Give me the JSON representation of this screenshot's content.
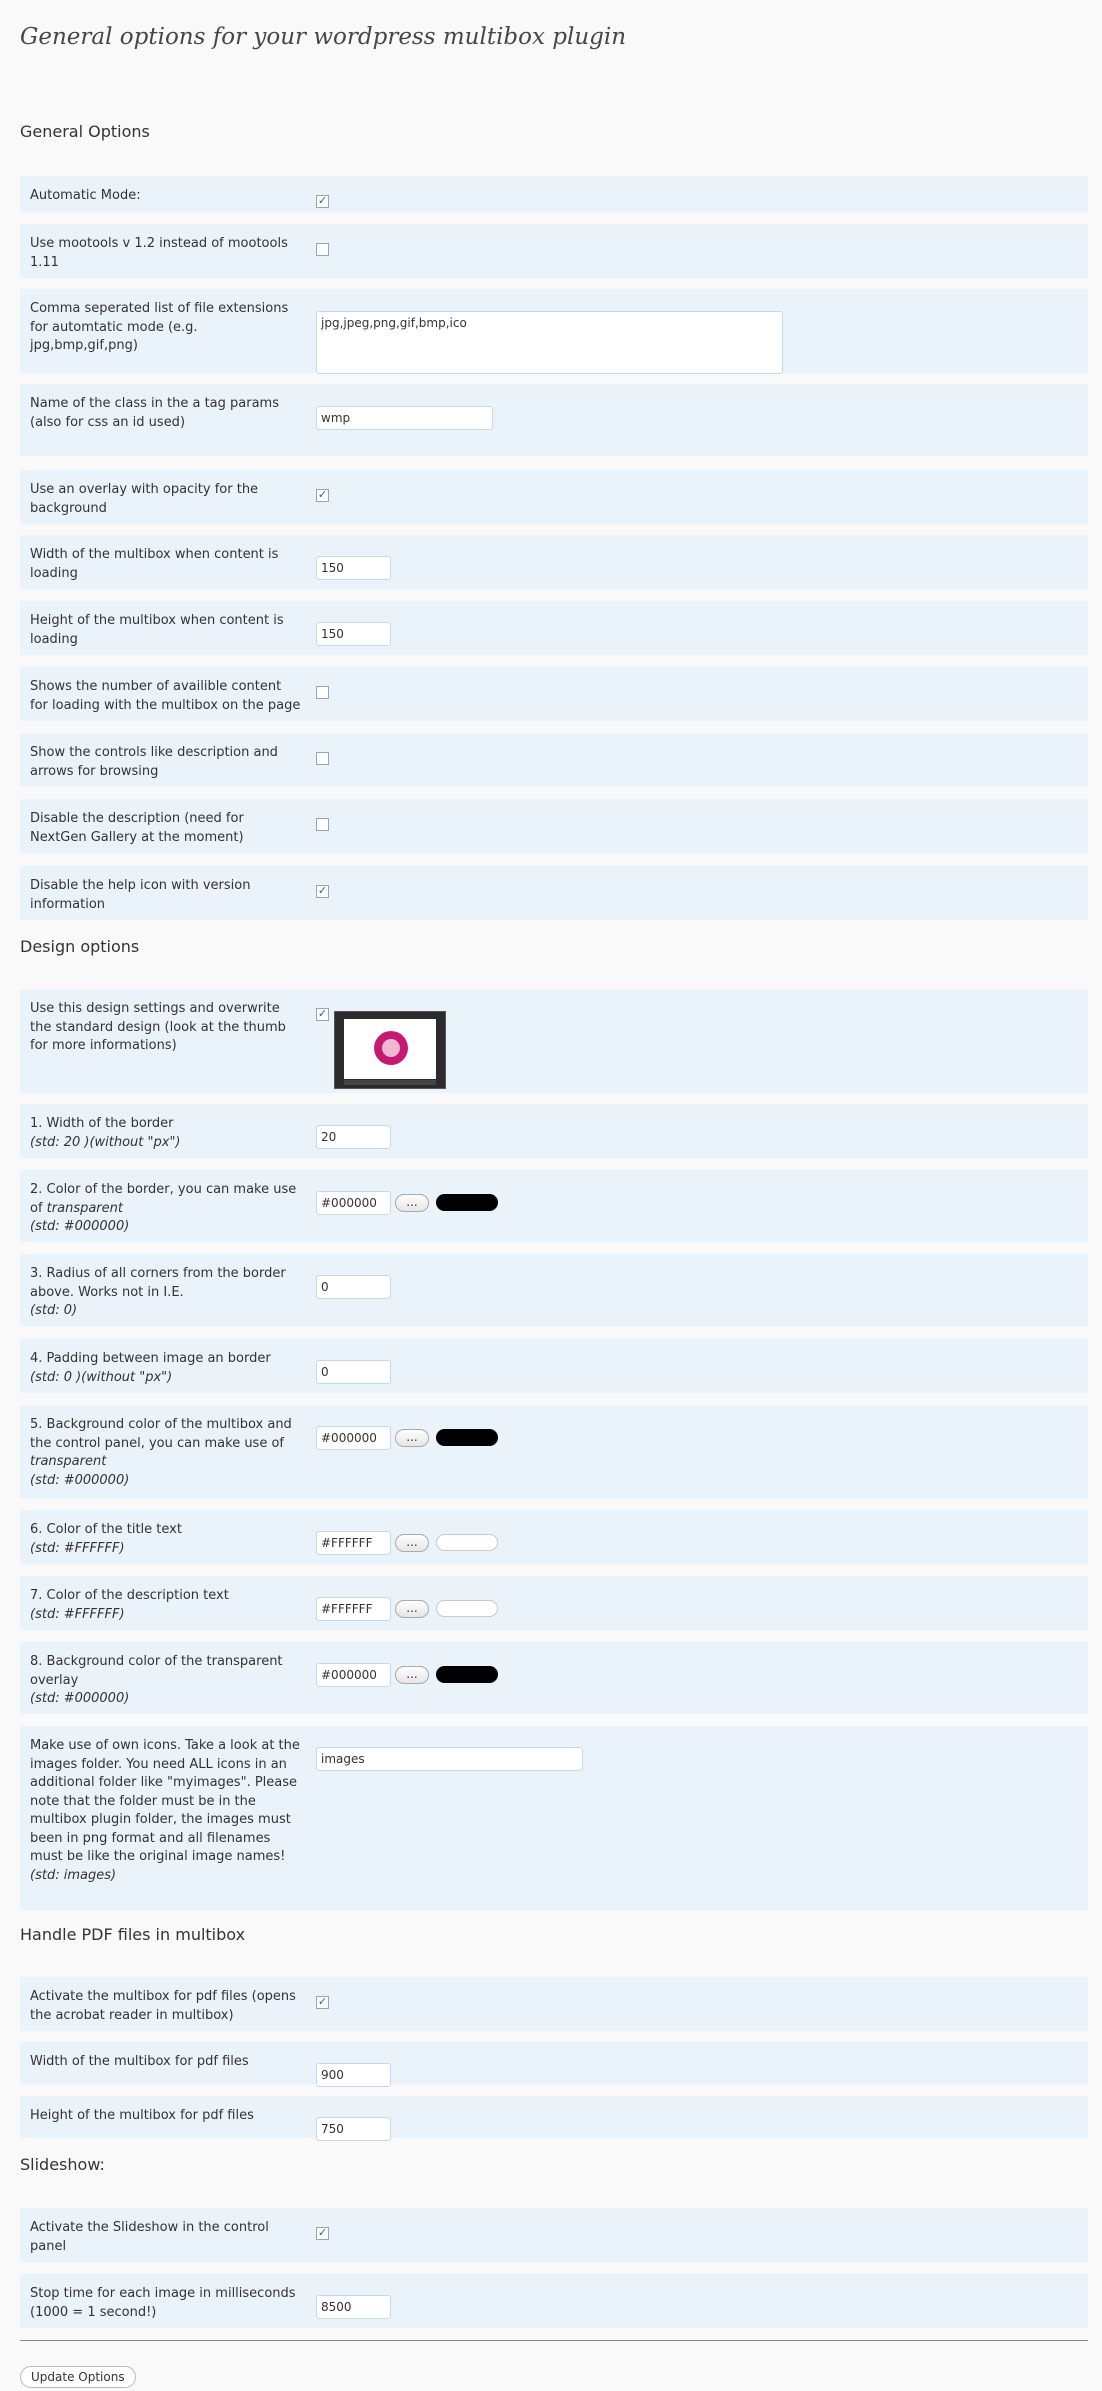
{
  "page_title": "General options for your wordpress multibox plugin",
  "sections": {
    "general": "General Options",
    "design": "Design options",
    "pdf": "Handle PDF files in multibox",
    "slideshow": "Slideshow:"
  },
  "general": {
    "automatic_mode": {
      "label": "Automatic Mode:",
      "checked": true
    },
    "mootools": {
      "label": "Use mootools v 1.2 instead of mootools 1.11",
      "checked": false
    },
    "extensions": {
      "label": "Comma seperated list of file extensions for automtatic mode (e.g. jpg,bmp,gif,png)",
      "value": "jpg,jpeg,png,gif,bmp,ico"
    },
    "class_name": {
      "label": "Name of the class in the a tag params (also for css an id used)",
      "value": "wmp"
    },
    "overlay": {
      "label": "Use an overlay with opacity for the background",
      "checked": true
    },
    "loading_width": {
      "label": "Width of the multibox when content is loading",
      "value": "150"
    },
    "loading_height": {
      "label": "Height of the multibox when content is loading",
      "value": "150"
    },
    "show_number": {
      "label": "Shows the number of availible content for loading with the multibox on the page",
      "checked": false
    },
    "show_controls": {
      "label": "Show the controls like description and arrows for browsing",
      "checked": false
    },
    "disable_description": {
      "label": "Disable the description (need for NextGen Gallery at the moment)",
      "checked": false
    },
    "disable_help": {
      "label": "Disable the help icon with version information",
      "checked": true
    }
  },
  "design": {
    "use_design": {
      "label": "Use this design settings and overwrite the standard design (look at the thumb for more informations)",
      "checked": true
    },
    "border_width": {
      "label": "1. Width of the border",
      "std": "(std: 20 )(without \"px\")",
      "value": "20"
    },
    "border_color": {
      "label_a": "2. Color of the border, you can make use of",
      "label_em": "transparent",
      "std": "(std: #000000)",
      "value": "#000000",
      "color": "#000000"
    },
    "radius": {
      "label": "3. Radius of all corners from the border above. Works not in I.E.",
      "std": "(std: 0)",
      "value": "0"
    },
    "padding": {
      "label": "4. Padding between image an border",
      "std": "(std: 0 )(without \"px\")",
      "value": "0"
    },
    "bg_color": {
      "label_a": "5. Background color of the multibox and the control panel, you can make use of",
      "label_em": "transparent",
      "std": "(std: #000000)",
      "value": "#000000",
      "color": "#000000"
    },
    "title_color": {
      "label": "6. Color of the title text",
      "std": "(std: #FFFFFF)",
      "value": "#FFFFFF",
      "color": "#FFFFFF"
    },
    "desc_color": {
      "label": "7. Color of the description text",
      "std": "(std: #FFFFFF)",
      "value": "#FFFFFF",
      "color": "#FFFFFF"
    },
    "overlay_color": {
      "label": "8. Background color of the transparent overlay",
      "std": "(std: #000000)",
      "value": "#000000",
      "color": "#000000"
    },
    "icons": {
      "label": "Make use of own icons. Take a look at the images folder. You need ALL icons in an additional folder like \"myimages\". Please note that the folder must be in the multibox plugin folder, the images must been in png format and all filenames must be like the original image names!",
      "std": "(std: images)",
      "value": "images"
    },
    "picker_label": "..."
  },
  "pdf": {
    "activate": {
      "label": "Activate the multibox for pdf files (opens the acrobat reader in multibox)",
      "checked": true
    },
    "width": {
      "label": "Width of the multibox for pdf files",
      "value": "900"
    },
    "height": {
      "label": "Height of the multibox for pdf files",
      "value": "750"
    }
  },
  "slideshow": {
    "activate": {
      "label": "Activate the Slideshow in the control panel",
      "checked": true
    },
    "stop_time": {
      "label": "Stop time for each image in milliseconds (1000 = 1 second!)",
      "value": "8500"
    }
  },
  "submit_label": "Update Options",
  "check_glyph": "✓"
}
